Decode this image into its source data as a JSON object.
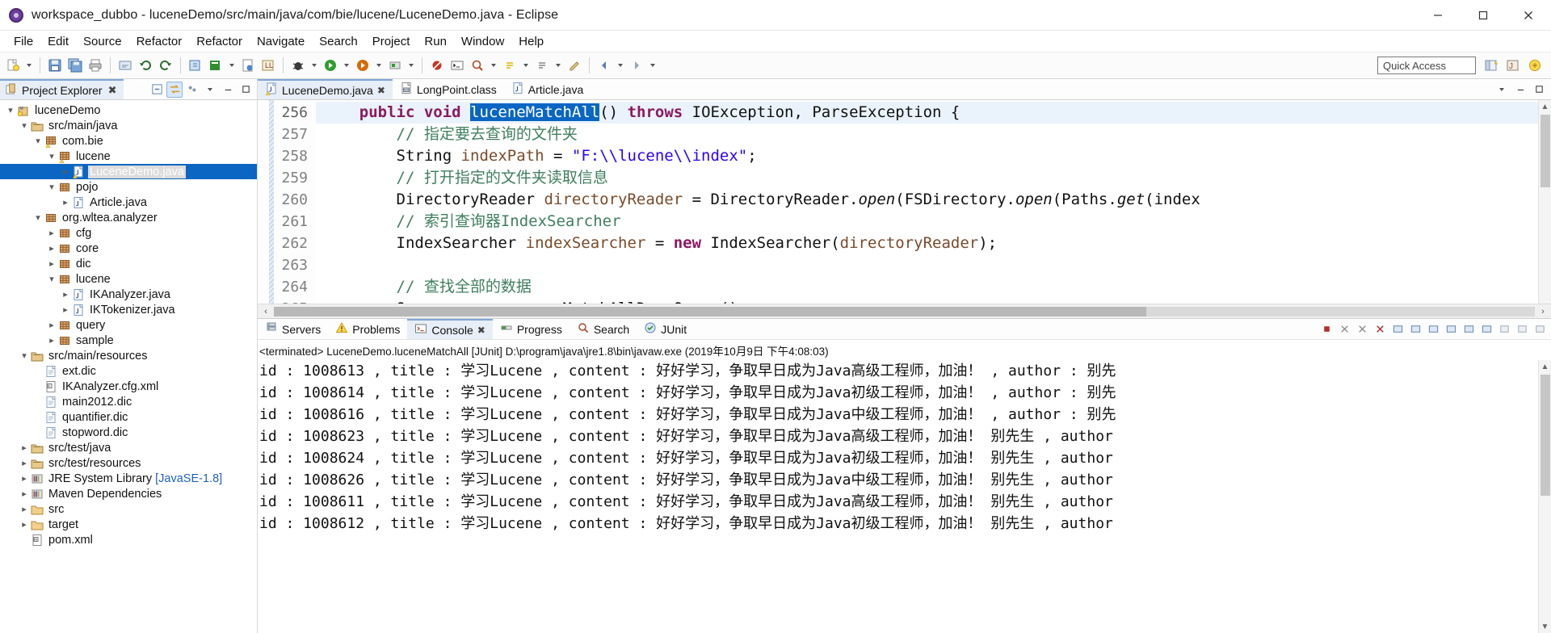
{
  "window": {
    "title": "workspace_dubbo - luceneDemo/src/main/java/com/bie/lucene/LuceneDemo.java - Eclipse",
    "app_icon": "eclipse-icon",
    "minimize": "minimize-icon",
    "maximize": "maximize-icon",
    "close": "close-icon"
  },
  "menubar": {
    "items": [
      {
        "label": "File"
      },
      {
        "label": "Edit"
      },
      {
        "label": "Source"
      },
      {
        "label": "Refactor"
      },
      {
        "label": "Refactor"
      },
      {
        "label": "Navigate"
      },
      {
        "label": "Search"
      },
      {
        "label": "Project"
      },
      {
        "label": "Run"
      },
      {
        "label": "Window"
      },
      {
        "label": "Help"
      }
    ]
  },
  "toolbar": {
    "quick_access_placeholder": "Quick Access",
    "quick_access_value": "Quick Access",
    "buttons": [
      "new-wizard-icon",
      "save-icon",
      "save-all-icon",
      "print-icon",
      "undo-icon",
      "redo-icon",
      "build-all-icon",
      "new-java-project-icon",
      "new-package-icon",
      "new-class-icon",
      "debug-icon",
      "run-icon",
      "coverage-icon",
      "external-tools-icon",
      "skip-breakpoints-icon",
      "terminal-icon",
      "open-type-icon",
      "search-icon",
      "next-annotation-icon",
      "previous-annotation-icon",
      "last-edit-location-icon",
      "back-icon",
      "forward-icon",
      "pin-editor-icon"
    ],
    "perspective_buttons": [
      "open-perspective-icon",
      "java-perspective-icon",
      "java-ee-perspective-icon"
    ]
  },
  "project_explorer": {
    "tab_label": "Project Explorer",
    "tab_close": "close-icon",
    "tools": [
      "collapse-all-icon",
      "link-with-editor-icon",
      "view-menu-icon",
      "view-dropdown-icon"
    ],
    "tree": [
      {
        "label": "luceneDemo",
        "indent": 0,
        "arrow": "down",
        "icon": "java-project-icon",
        "selected": false
      },
      {
        "label": "src/main/java",
        "indent": 1,
        "arrow": "down",
        "icon": "source-folder-icon",
        "selected": false
      },
      {
        "label": "com.bie",
        "indent": 2,
        "arrow": "down",
        "icon": "package-warn-icon",
        "selected": false
      },
      {
        "label": "lucene",
        "indent": 3,
        "arrow": "down",
        "icon": "package-warn-icon",
        "selected": false
      },
      {
        "label": "LuceneDemo.java",
        "indent": 4,
        "arrow": "right",
        "icon": "java-file-warn-icon",
        "selected": true
      },
      {
        "label": "pojo",
        "indent": 3,
        "arrow": "down",
        "icon": "package-icon",
        "selected": false
      },
      {
        "label": "Article.java",
        "indent": 4,
        "arrow": "right",
        "icon": "java-file-icon",
        "selected": false
      },
      {
        "label": "org.wltea.analyzer",
        "indent": 2,
        "arrow": "down",
        "icon": "package-icon",
        "selected": false
      },
      {
        "label": "cfg",
        "indent": 3,
        "arrow": "right",
        "icon": "package-icon",
        "selected": false
      },
      {
        "label": "core",
        "indent": 3,
        "arrow": "right",
        "icon": "package-icon",
        "selected": false
      },
      {
        "label": "dic",
        "indent": 3,
        "arrow": "right",
        "icon": "package-icon",
        "selected": false
      },
      {
        "label": "lucene",
        "indent": 3,
        "arrow": "down",
        "icon": "package-icon",
        "selected": false
      },
      {
        "label": "IKAnalyzer.java",
        "indent": 4,
        "arrow": "right",
        "icon": "java-file-icon",
        "selected": false
      },
      {
        "label": "IKTokenizer.java",
        "indent": 4,
        "arrow": "right",
        "icon": "java-file-icon",
        "selected": false
      },
      {
        "label": "query",
        "indent": 3,
        "arrow": "right",
        "icon": "package-icon",
        "selected": false
      },
      {
        "label": "sample",
        "indent": 3,
        "arrow": "right",
        "icon": "package-icon",
        "selected": false
      },
      {
        "label": "src/main/resources",
        "indent": 1,
        "arrow": "down",
        "icon": "source-folder-icon",
        "selected": false
      },
      {
        "label": "ext.dic",
        "indent": 2,
        "arrow": "none",
        "icon": "file-icon",
        "selected": false
      },
      {
        "label": "IKAnalyzer.cfg.xml",
        "indent": 2,
        "arrow": "none",
        "icon": "xml-file-icon",
        "selected": false
      },
      {
        "label": "main2012.dic",
        "indent": 2,
        "arrow": "none",
        "icon": "file-icon",
        "selected": false
      },
      {
        "label": "quantifier.dic",
        "indent": 2,
        "arrow": "none",
        "icon": "file-icon",
        "selected": false
      },
      {
        "label": "stopword.dic",
        "indent": 2,
        "arrow": "none",
        "icon": "file-icon",
        "selected": false
      },
      {
        "label": "src/test/java",
        "indent": 1,
        "arrow": "right",
        "icon": "source-folder-icon",
        "selected": false
      },
      {
        "label": "src/test/resources",
        "indent": 1,
        "arrow": "right",
        "icon": "source-folder-icon",
        "selected": false
      },
      {
        "label": "JRE System Library",
        "indent": 1,
        "arrow": "right",
        "icon": "library-icon",
        "selected": false,
        "suffix": " [JavaSE-1.8]"
      },
      {
        "label": "Maven Dependencies",
        "indent": 1,
        "arrow": "right",
        "icon": "library-icon",
        "selected": false
      },
      {
        "label": "src",
        "indent": 1,
        "arrow": "right",
        "icon": "folder-icon",
        "selected": false
      },
      {
        "label": "target",
        "indent": 1,
        "arrow": "right",
        "icon": "folder-icon",
        "selected": false
      },
      {
        "label": "pom.xml",
        "indent": 1,
        "arrow": "none",
        "icon": "maven-file-icon",
        "selected": false
      }
    ]
  },
  "editor": {
    "tabs": [
      {
        "label": "LuceneDemo.java",
        "icon": "java-file-warn-icon",
        "active": true,
        "close": "close-icon"
      },
      {
        "label": "LongPoint.class",
        "icon": "class-file-icon",
        "active": false
      },
      {
        "label": "Article.java",
        "icon": "java-file-icon",
        "active": false
      }
    ],
    "tools": [
      "editor-dropdown-icon",
      "minimize-icon",
      "maximize-icon"
    ],
    "first_line_number": 256,
    "lines": [
      {
        "num": "256",
        "current": true,
        "text": "    public void luceneMatchAll() throws IOException, ParseException {"
      },
      {
        "num": "257",
        "current": false,
        "text": "        // 指定要去查询的文件夹"
      },
      {
        "num": "258",
        "current": false,
        "text": "        String indexPath = \"F:\\\\lucene\\\\index\";"
      },
      {
        "num": "259",
        "current": false,
        "text": "        // 打开指定的文件夹读取信息"
      },
      {
        "num": "260",
        "current": false,
        "text": "        DirectoryReader directoryReader = DirectoryReader.open(FSDirectory.open(Paths.get(index"
      },
      {
        "num": "261",
        "current": false,
        "text": "        // 索引查询器IndexSearcher"
      },
      {
        "num": "262",
        "current": false,
        "text": "        IndexSearcher indexSearcher = new IndexSearcher(directoryReader);"
      },
      {
        "num": "263",
        "current": false,
        "text": ""
      },
      {
        "num": "264",
        "current": false,
        "text": "        // 查找全部的数据"
      },
      {
        "num": "265",
        "current": false,
        "text": "        Query query = new MatchAllDocsQuery();"
      }
    ],
    "selected_token": "luceneMatchAll",
    "hscroll_left_arrow": "chevron-left-icon",
    "hscroll_right_arrow": "chevron-right-icon"
  },
  "console_panel": {
    "tabs": [
      {
        "label": "Servers",
        "icon": "servers-icon",
        "active": false
      },
      {
        "label": "Problems",
        "icon": "problems-icon",
        "active": false
      },
      {
        "label": "Console",
        "icon": "console-icon",
        "active": true,
        "close": "close-icon"
      },
      {
        "label": "Progress",
        "icon": "progress-icon",
        "active": false
      },
      {
        "label": "Search",
        "icon": "search-icon",
        "active": false
      },
      {
        "label": "JUnit",
        "icon": "junit-icon",
        "active": false
      }
    ],
    "tools": [
      "terminate-icon",
      "remove-launch-icon",
      "remove-all-icon",
      "clear-console-icon",
      "scroll-lock-icon",
      "word-wrap-icon",
      "show-console-icon",
      "pin-console-icon",
      "display-selected-console-icon",
      "open-console-icon",
      "view-menu-icon",
      "minimize-icon",
      "maximize-icon"
    ],
    "terminated_line": "<terminated> LuceneDemo.luceneMatchAll [JUnit] D:\\program\\java\\jre1.8\\bin\\javaw.exe (2019年10月9日 下午4:08:03)",
    "output_lines": [
      "id : 1008613 , title : 学习Lucene , content : 好好学习，争取早日成为Java高级工程师，加油！ , author : 别先",
      "id : 1008614 , title : 学习Lucene , content : 好好学习，争取早日成为Java初级工程师，加油！ , author : 别先",
      "id : 1008616 , title : 学习Lucene , content : 好好学习，争取早日成为Java中级工程师，加油！ , author : 别先",
      "id : 1008623 , title : 学习Lucene , content : 好好学习，争取早日成为Java高级工程师，加油！ 别先生 , author",
      "id : 1008624 , title : 学习Lucene , content : 好好学习，争取早日成为Java初级工程师，加油！ 别先生 , author",
      "id : 1008626 , title : 学习Lucene , content : 好好学习，争取早日成为Java中级工程师，加油！ 别先生 , author",
      "id : 1008611 , title : 学习Lucene , content : 好好学习，争取早日成为Java高级工程师，加油！ 别先生 , author",
      "id : 1008612 , title : 学习Lucene , content : 好好学习，争取早日成为Java初级工程师，加油！ 别先生 , author"
    ]
  },
  "colors": {
    "accent": "#0a66c2",
    "tab_active_bg": "#e8eef7",
    "tab_active_border": "#7ea6d9",
    "keyword": "#8b1a62",
    "comment": "#3f7f5f",
    "string": "#2a00ff",
    "field": "#7a4b2a",
    "link": "#2060c0"
  }
}
